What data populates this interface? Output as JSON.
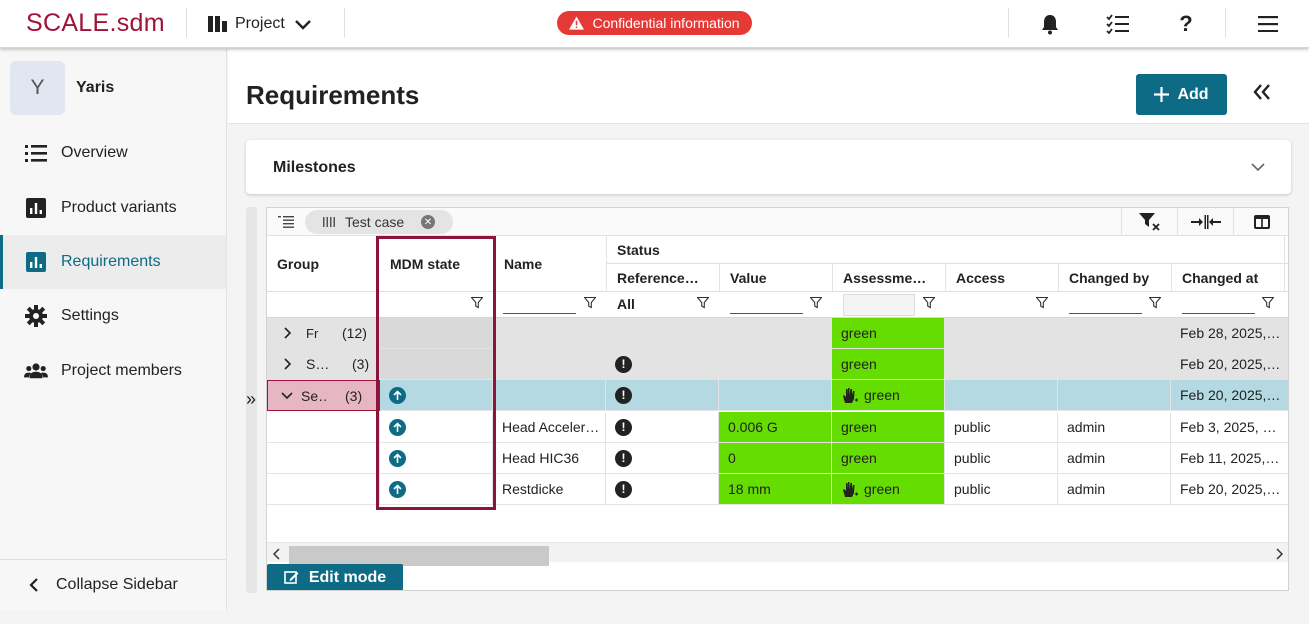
{
  "header": {
    "logo": "SCALE.sdm",
    "project_label": "Project",
    "confidential": "Confidential information",
    "icons": [
      "bars-chart-icon",
      "chevron-down-icon",
      "warning-icon",
      "bell-icon",
      "checklist-icon",
      "help-icon",
      "menu-icon"
    ],
    "help_glyph": "?"
  },
  "sidebar": {
    "avatar_letter": "Y",
    "project_name": "Yaris",
    "items": [
      {
        "label": "Overview",
        "icon": "list-icon"
      },
      {
        "label": "Product variants",
        "icon": "bar-chart-icon"
      },
      {
        "label": "Requirements",
        "icon": "bar-chart-icon",
        "active": true
      },
      {
        "label": "Settings",
        "icon": "gear-icon"
      },
      {
        "label": "Project members",
        "icon": "people-icon"
      }
    ],
    "collapse_label": "Collapse Sidebar"
  },
  "main": {
    "title": "Requirements",
    "add_label": "Add",
    "milestones_label": "Milestones",
    "expand_glyph": "»",
    "edit_mode_label": "Edit mode"
  },
  "grid": {
    "group_chip": "Test case",
    "headers": {
      "group": "Group",
      "mdm": "MDM state",
      "name": "Name",
      "status": "Status",
      "reference": "Reference…",
      "value": "Value",
      "assessment": "Assessme…",
      "access": "Access",
      "changed_by": "Changed by",
      "changed_at": "Changed at"
    },
    "filter_reference_value": "All",
    "rows": [
      {
        "group": "Fr",
        "count": "(12)",
        "mdm": "",
        "name": "",
        "ref": "",
        "value": "",
        "assess": "green",
        "access": "",
        "by": "",
        "at": "Feb 28, 2025,…"
      },
      {
        "group": "S…",
        "count": "(3)",
        "mdm": "",
        "name": "",
        "ref": "!",
        "value": "",
        "assess": "green",
        "access": "",
        "by": "",
        "at": "Feb 20, 2025,…"
      },
      {
        "group": "Se…",
        "count": "(3)",
        "mdm": "up",
        "name": "",
        "ref": "!",
        "value": "",
        "assess": "green",
        "access": "",
        "by": "",
        "at": "Feb 20, 2025,…"
      },
      {
        "group": "",
        "count": "",
        "mdm": "up",
        "name": "Head Acceler…",
        "ref": "!",
        "value": "0.006 G",
        "assess": "green",
        "access": "public",
        "by": "admin",
        "at": "Feb 3, 2025, …"
      },
      {
        "group": "",
        "count": "",
        "mdm": "up",
        "name": "Head HIC36",
        "ref": "!",
        "value": "0",
        "assess": "green",
        "access": "public",
        "by": "admin",
        "at": "Feb 11, 2025,…"
      },
      {
        "group": "",
        "count": "",
        "mdm": "up",
        "name": "Restdicke",
        "ref": "!",
        "value": "18 mm",
        "assess": "green",
        "access": "public",
        "by": "admin",
        "at": "Feb 20, 2025,…"
      }
    ]
  },
  "colors": {
    "brand": "#a0123a",
    "accent": "#0d6b85",
    "danger": "#e53935",
    "assessment_green": "#66dd00",
    "selected_row": "#b4d9e2",
    "selected_group": "#e6b6c4",
    "highlight_box": "#8b1538"
  }
}
